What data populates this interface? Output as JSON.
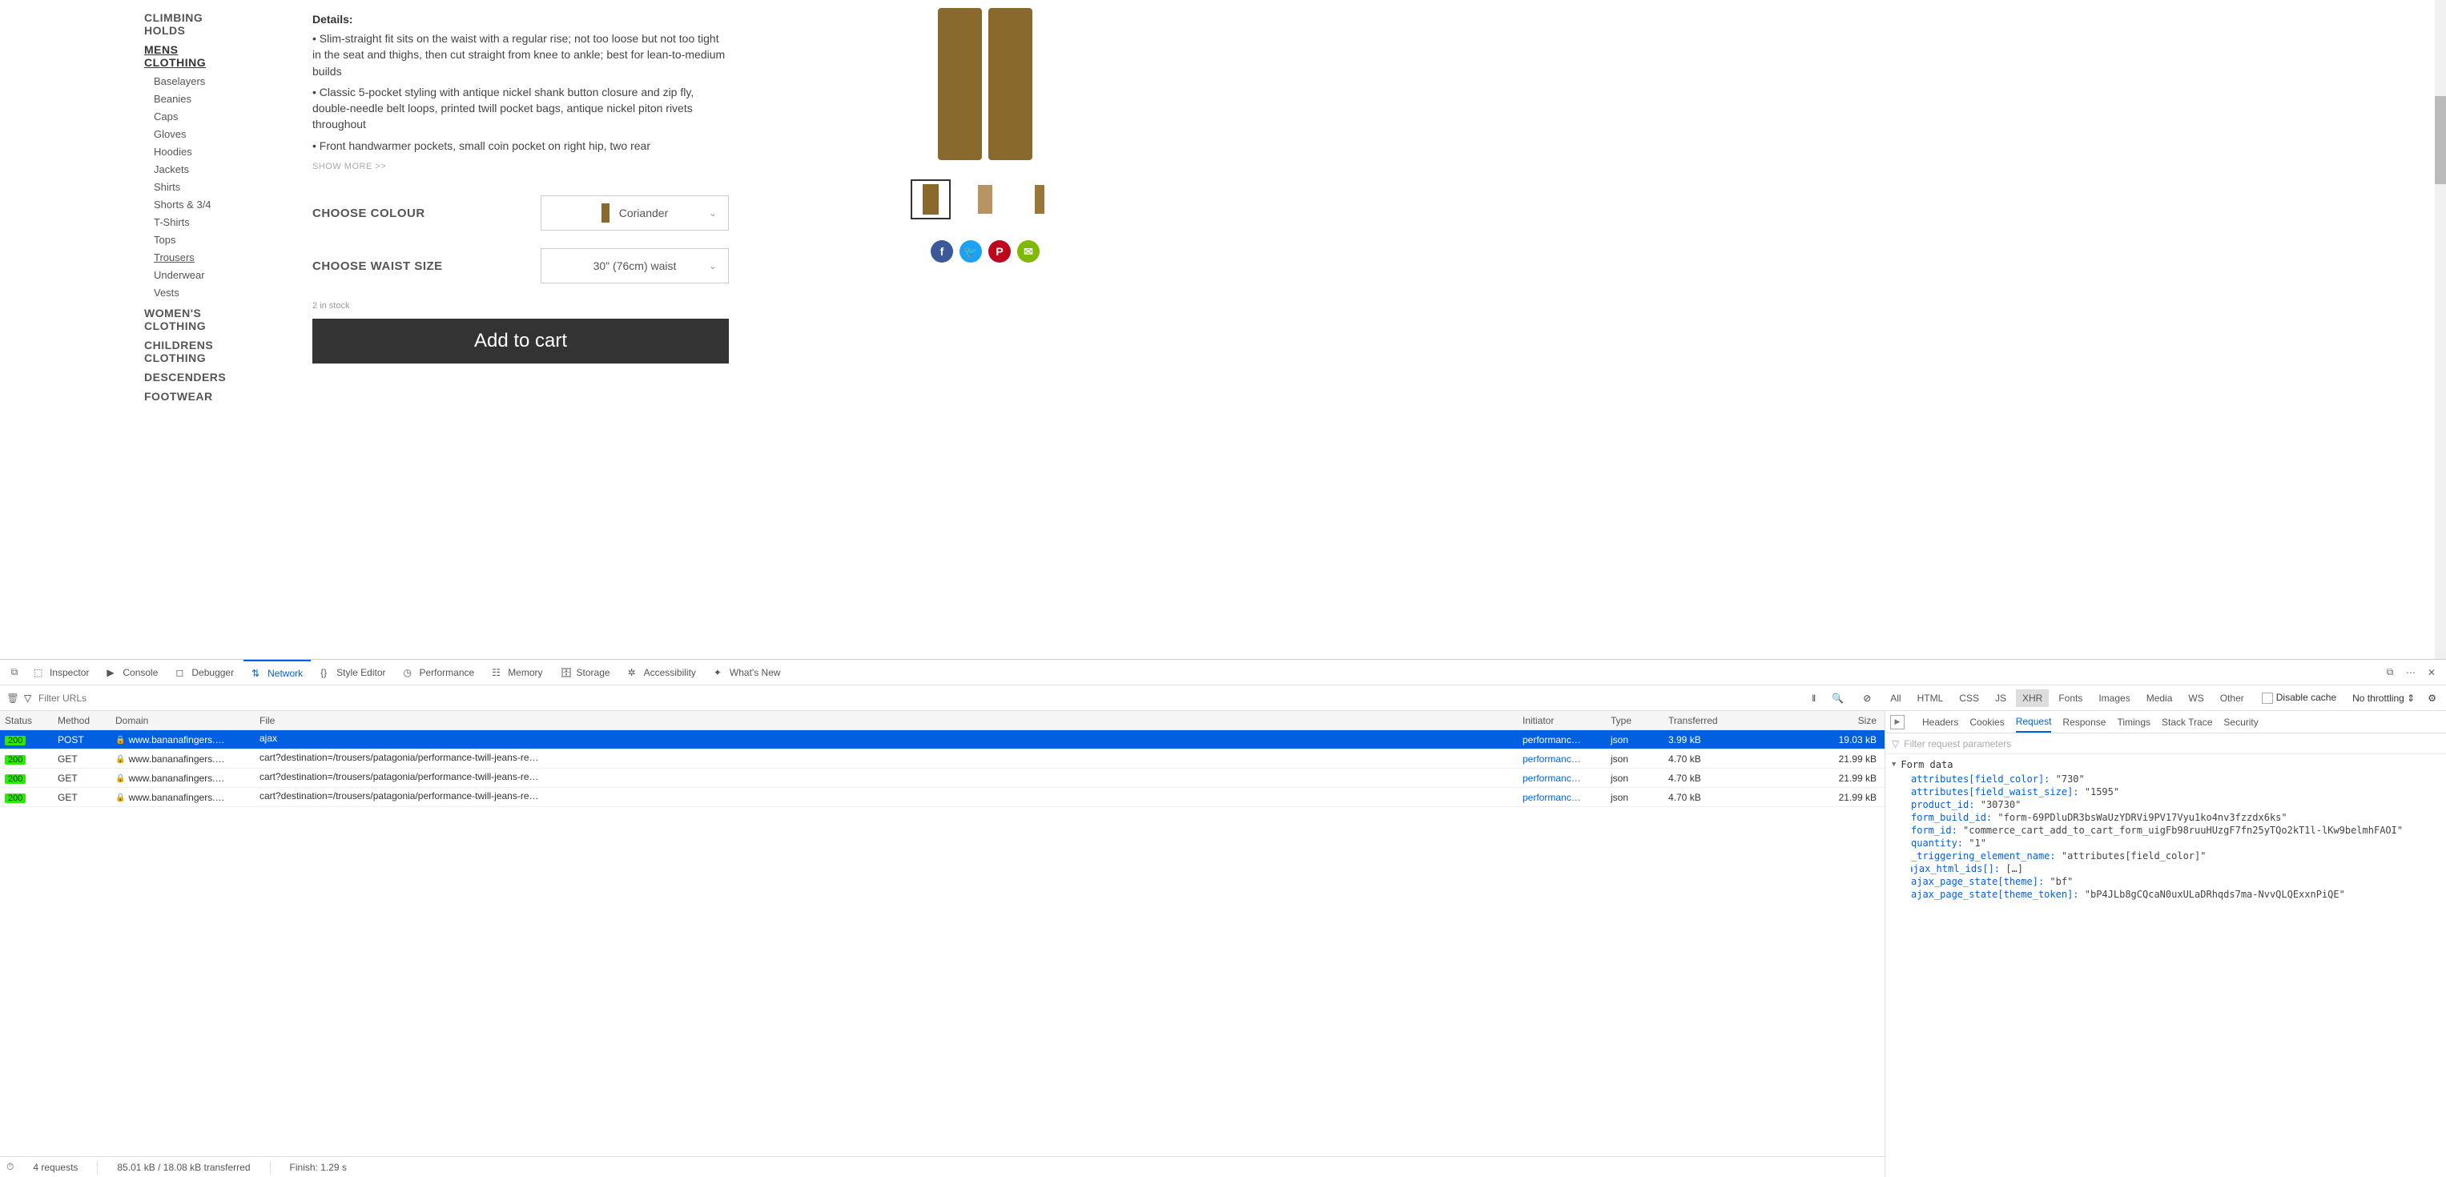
{
  "sidebar": {
    "cats": [
      {
        "label": "CLIMBING HOLDS",
        "link": false
      },
      {
        "label": "MENS CLOTHING",
        "link": true
      }
    ],
    "subcats": [
      {
        "label": "Baselayers"
      },
      {
        "label": "Beanies"
      },
      {
        "label": "Caps"
      },
      {
        "label": "Gloves"
      },
      {
        "label": "Hoodies"
      },
      {
        "label": "Jackets"
      },
      {
        "label": "Shirts"
      },
      {
        "label": "Shorts & 3/4"
      },
      {
        "label": "T-Shirts"
      },
      {
        "label": "Tops"
      },
      {
        "label": "Trousers",
        "active": true
      },
      {
        "label": "Underwear"
      },
      {
        "label": "Vests"
      }
    ],
    "cats2": [
      {
        "label": "WOMEN'S CLOTHING"
      },
      {
        "label": "CHILDRENS CLOTHING"
      },
      {
        "label": "DESCENDERS"
      },
      {
        "label": "FOOTWEAR"
      }
    ]
  },
  "product": {
    "details_label": "Details:",
    "bullets": [
      "• Slim-straight fit sits on the waist with a regular rise; not too loose but not too tight in the seat and thighs, then cut straight from knee to ankle; best for lean-to-medium builds",
      "• Classic 5-pocket styling with antique nickel shank button closure and zip fly, double-needle belt loops, printed twill pocket bags, antique nickel piton rivets throughout",
      "• Front handwarmer pockets, small coin pocket on right hip, two rear"
    ],
    "showmore": "SHOW MORE >>",
    "colour_label": "CHOOSE COLOUR",
    "colour_value": "Coriander",
    "size_label": "CHOOSE WAIST SIZE",
    "size_value": "30\" (76cm) waist",
    "stock": "2 in stock",
    "add_cart": "Add to cart"
  },
  "devtools": {
    "tabs": [
      {
        "label": "Inspector",
        "icon": "inspector"
      },
      {
        "label": "Console",
        "icon": "console"
      },
      {
        "label": "Debugger",
        "icon": "debugger"
      },
      {
        "label": "Network",
        "icon": "network",
        "active": true
      },
      {
        "label": "Style Editor",
        "icon": "style"
      },
      {
        "label": "Performance",
        "icon": "perf"
      },
      {
        "label": "Memory",
        "icon": "memory"
      },
      {
        "label": "Storage",
        "icon": "storage"
      },
      {
        "label": "Accessibility",
        "icon": "a11y"
      },
      {
        "label": "What's New",
        "icon": "new"
      }
    ],
    "filter_placeholder": "Filter URLs",
    "filter_types": [
      "All",
      "HTML",
      "CSS",
      "JS",
      "XHR",
      "Fonts",
      "Images",
      "Media",
      "WS",
      "Other"
    ],
    "filter_active": "XHR",
    "disable_cache": "Disable cache",
    "throttling": "No throttling",
    "columns": [
      "Status",
      "Method",
      "Domain",
      "File",
      "Initiator",
      "Type",
      "Transferred",
      "Size"
    ],
    "rows": [
      {
        "status": "200",
        "method": "POST",
        "domain": "www.bananafingers.…",
        "file": "ajax",
        "initiator": "performanc…",
        "type": "json",
        "transferred": "3.99 kB",
        "size": "19.03 kB",
        "selected": true
      },
      {
        "status": "200",
        "method": "GET",
        "domain": "www.bananafingers.…",
        "file": "cart?destination=/trousers/patagonia/performance-twill-jeans-re…",
        "initiator": "performanc…",
        "type": "json",
        "transferred": "4.70 kB",
        "size": "21.99 kB"
      },
      {
        "status": "200",
        "method": "GET",
        "domain": "www.bananafingers.…",
        "file": "cart?destination=/trousers/patagonia/performance-twill-jeans-re…",
        "initiator": "performanc…",
        "type": "json",
        "transferred": "4.70 kB",
        "size": "21.99 kB"
      },
      {
        "status": "200",
        "method": "GET",
        "domain": "www.bananafingers.…",
        "file": "cart?destination=/trousers/patagonia/performance-twill-jeans-re…",
        "initiator": "performanc…",
        "type": "json",
        "transferred": "4.70 kB",
        "size": "21.99 kB"
      }
    ],
    "req_tabs": [
      "Headers",
      "Cookies",
      "Request",
      "Response",
      "Timings",
      "Stack Trace",
      "Security"
    ],
    "req_active": "Request",
    "req_filter_placeholder": "Filter request parameters",
    "form_section": "Form data",
    "form_data": [
      {
        "k": "attributes[field_color]:",
        "v": "\"730\""
      },
      {
        "k": "attributes[field_waist_size]:",
        "v": "\"1595\""
      },
      {
        "k": "product_id:",
        "v": "\"30730\""
      },
      {
        "k": "form_build_id:",
        "v": "\"form-69PDluDR3bsWaUzYDRVi9PV17Vyu1ko4nv3fzzdx6ks\""
      },
      {
        "k": "form_id:",
        "v": "\"commerce_cart_add_to_cart_form_uigFb98ruuHUzgF7fn25yTQo2kT1l-lKw9belmhFAOI\""
      },
      {
        "k": "quantity:",
        "v": "\"1\""
      },
      {
        "k": "_triggering_element_name:",
        "v": "\"attributes[field_color]\""
      },
      {
        "k": "ajax_html_ids[]:",
        "v": "[…]",
        "tri": true
      },
      {
        "k": "ajax_page_state[theme]:",
        "v": "\"bf\""
      },
      {
        "k": "ajax_page_state[theme_token]:",
        "v": "\"bP4JLb8gCQcaN0uxULaDRhqds7ma-NvvQLQExxnPiQE\""
      }
    ],
    "status_bar": {
      "requests": "4 requests",
      "transferred": "85.01 kB / 18.08 kB transferred",
      "finish": "Finish: 1.29 s"
    }
  }
}
